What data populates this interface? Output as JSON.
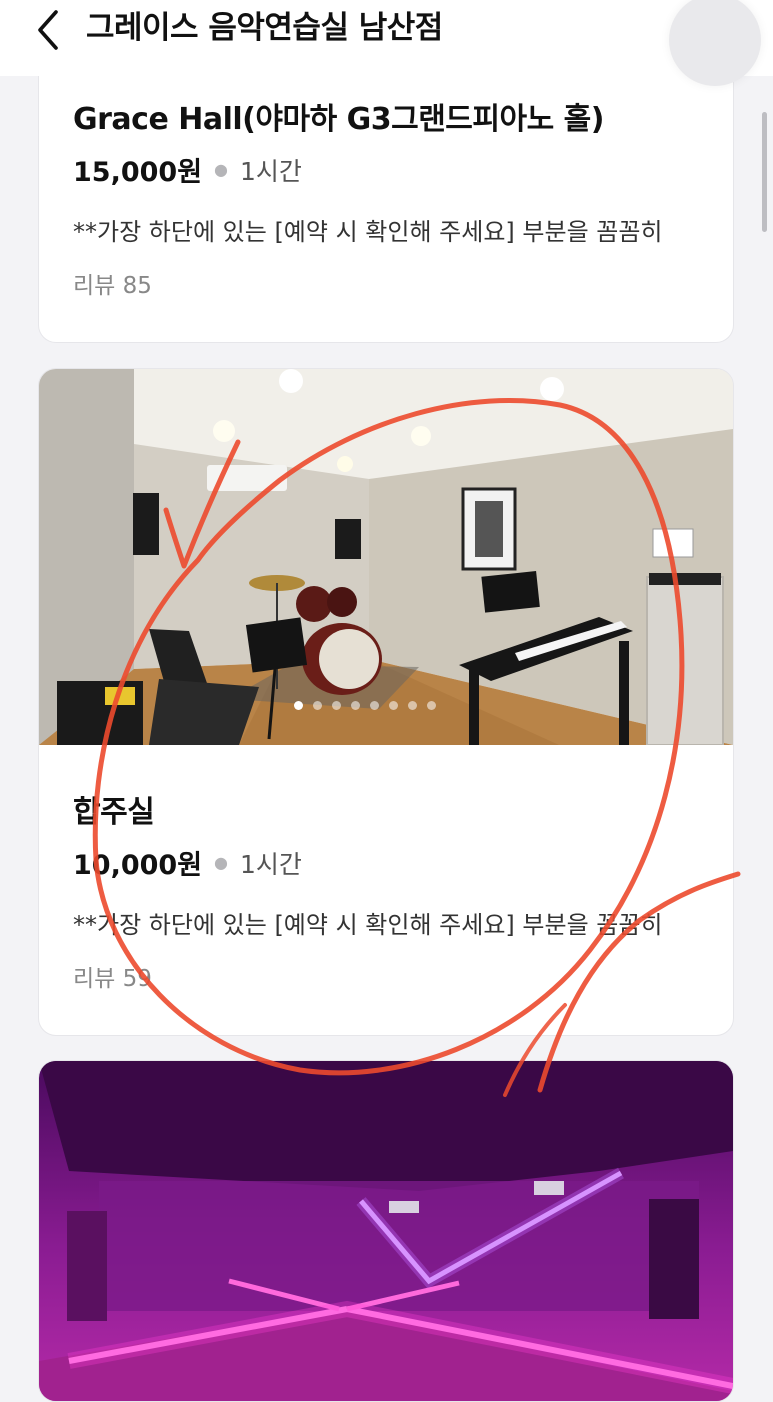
{
  "header": {
    "title": "그레이스 음악연습실 남산점"
  },
  "rooms": [
    {
      "title": "Grace Hall(야마하 G3그랜드피아노 홀)",
      "price": "15,000원",
      "duration": "1시간",
      "description": "**가장 하단에 있는 [예약 시 확인해 주세요] 부분을 꼼꼼히",
      "reviews": "리뷰 85"
    },
    {
      "title": "합주실",
      "price": "10,000원",
      "duration": "1시간",
      "description": "**가장 하단에 있는 [예약 시 확인해 주세요] 부분을 꼼꼼히",
      "reviews": "리뷰 59"
    }
  ],
  "colors": {
    "accent_annotation": "#ec4a2e",
    "studio_wall": "#cfc9bd",
    "studio_floor": "#b07a45",
    "dance_room_neon": "#ff3fd8"
  }
}
